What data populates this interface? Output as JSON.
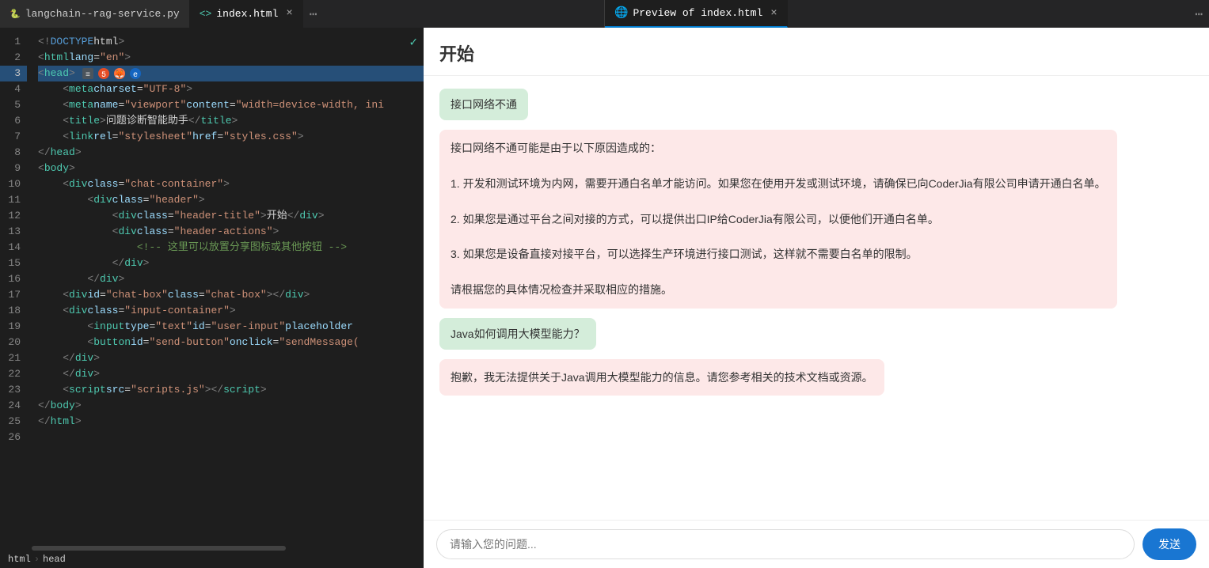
{
  "tabs": {
    "left": [
      {
        "id": "python-tab",
        "icon": "🐍",
        "label": "langchain--rag-service.py",
        "active": false,
        "closable": false
      },
      {
        "id": "html-tab",
        "icon": "<>",
        "label": "index.html",
        "active": true,
        "closable": true
      }
    ],
    "right": [
      {
        "id": "preview-tab",
        "icon": "🌐",
        "label": "Preview of index.html",
        "active": true,
        "closable": true
      }
    ]
  },
  "editor": {
    "checkmark": "✓",
    "lines": [
      {
        "num": 1,
        "content": "<!DOCTYPE html>"
      },
      {
        "num": 2,
        "content": "<html lang=\"en\">"
      },
      {
        "num": 3,
        "content": "<head>",
        "highlighted": true
      },
      {
        "num": 4,
        "content": "    <meta charset=\"UTF-8\">"
      },
      {
        "num": 5,
        "content": "    <meta name=\"viewport\" content=\"width=device-width, ini"
      },
      {
        "num": 6,
        "content": "    <title>问题诊断智能助手</title>"
      },
      {
        "num": 7,
        "content": "    <link rel=\"stylesheet\" href=\"styles.css\">"
      },
      {
        "num": 8,
        "content": "</head>"
      },
      {
        "num": 9,
        "content": "<body>"
      },
      {
        "num": 10,
        "content": "    <div class=\"chat-container\">"
      },
      {
        "num": 11,
        "content": "        <div class=\"header\">"
      },
      {
        "num": 12,
        "content": "            <div class=\"header-title\">开始</div>"
      },
      {
        "num": 13,
        "content": "            <div class=\"header-actions\">"
      },
      {
        "num": 14,
        "content": "                <!-- 这里可以放置分享图标或其他按钮 -->"
      },
      {
        "num": 15,
        "content": "            </div>"
      },
      {
        "num": 16,
        "content": "        </div>"
      },
      {
        "num": 17,
        "content": "    <div id=\"chat-box\" class=\"chat-box\"></div>"
      },
      {
        "num": 18,
        "content": "    <div class=\"input-container\">"
      },
      {
        "num": 19,
        "content": "        <input type=\"text\" id=\"user-input\" placeholder"
      },
      {
        "num": 20,
        "content": "        <button id=\"send-button\" onclick=\"sendMessage("
      },
      {
        "num": 21,
        "content": "    </div>"
      },
      {
        "num": 22,
        "content": "    </div>"
      },
      {
        "num": 23,
        "content": "    <script src=\"scripts.js\"></script>"
      },
      {
        "num": 24,
        "content": "</body>"
      },
      {
        "num": 25,
        "content": "</html>"
      },
      {
        "num": 26,
        "content": ""
      }
    ],
    "line3_icons": [
      {
        "color": "#888888",
        "label": "icon-1"
      },
      {
        "color": "#e44d26",
        "label": "icon-2"
      },
      {
        "color": "#ff7139",
        "label": "icon-3"
      },
      {
        "color": "#1565c0",
        "label": "icon-4"
      }
    ]
  },
  "breadcrumb": {
    "items": [
      "html",
      "head"
    ]
  },
  "preview": {
    "title": "开始",
    "messages": [
      {
        "type": "user",
        "text": "接口网络不通"
      },
      {
        "type": "ai",
        "text": "接口网络不通可能是由于以下原因造成的：\n\n1. 开发和测试环境为内网，需要开通白名单才能访问。如果您在使用开发或测试环境，请确保已向CoderJia有限公司申请开通白名单。\n\n2. 如果您是通过平台之间对接的方式，可以提供出口IP给CoderJia有限公司，以便他们开通白名单。\n\n3. 如果您是设备直接对接平台，可以选择生产环境进行接口测试，这样就不需要白名单的限制。\n\n请根据您的具体情况检查并采取相应的措施。"
      },
      {
        "type": "user",
        "text": "Java如何调用大模型能力？"
      },
      {
        "type": "ai",
        "text": "抱歉，我无法提供关于Java调用大模型能力的信息。请您参考相关的技术文档或资源。"
      }
    ],
    "input_placeholder": "请输入您的问题...",
    "send_button": "发送"
  }
}
